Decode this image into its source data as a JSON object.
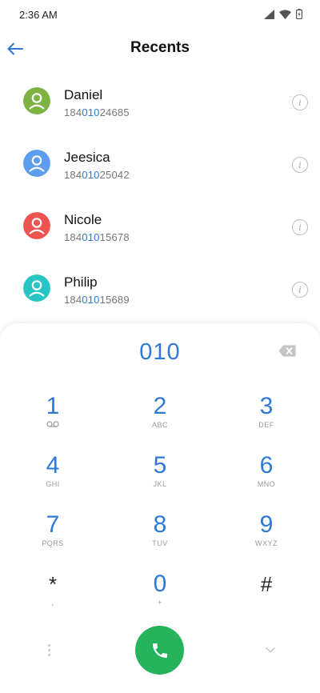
{
  "status_bar": {
    "time": "2:36 AM"
  },
  "header": {
    "title": "Recents"
  },
  "contacts": [
    {
      "name": "Daniel",
      "number_pre": "184",
      "number_match": "010",
      "number_post": "24685",
      "avatar_color": "#7cb342"
    },
    {
      "name": "Jeesica",
      "number_pre": "184",
      "number_match": "010",
      "number_post": "25042",
      "avatar_color": "#5c9ded"
    },
    {
      "name": "Nicole",
      "number_pre": "184",
      "number_match": "010",
      "number_post": "15678",
      "avatar_color": "#ef5350"
    },
    {
      "name": "Philip",
      "number_pre": "184",
      "number_match": "010",
      "number_post": "15689",
      "avatar_color": "#26c6c6"
    }
  ],
  "dialpad": {
    "input": "010",
    "keys": [
      {
        "digit": "1",
        "sub": ""
      },
      {
        "digit": "2",
        "sub": "ABC"
      },
      {
        "digit": "3",
        "sub": "DEF"
      },
      {
        "digit": "4",
        "sub": "GHI"
      },
      {
        "digit": "5",
        "sub": "JKL"
      },
      {
        "digit": "6",
        "sub": "MNO"
      },
      {
        "digit": "7",
        "sub": "PQRS"
      },
      {
        "digit": "8",
        "sub": "TUV"
      },
      {
        "digit": "9",
        "sub": "WXYZ"
      },
      {
        "digit": "*",
        "sub": ","
      },
      {
        "digit": "0",
        "sub": "+"
      },
      {
        "digit": "#",
        "sub": ""
      }
    ]
  },
  "colors": {
    "accent": "#2e78d6",
    "call": "#27b35c"
  }
}
